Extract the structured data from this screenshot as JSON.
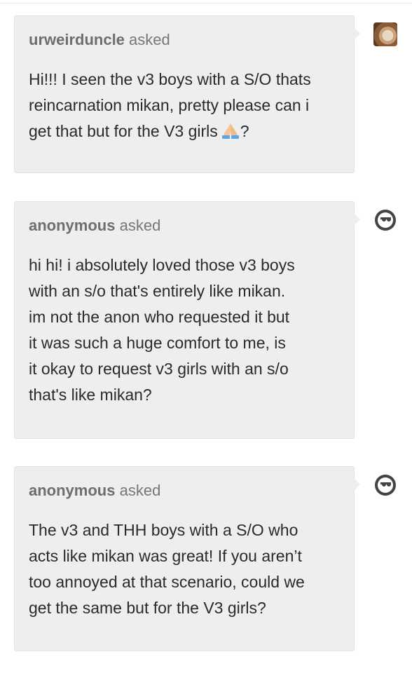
{
  "asks": [
    {
      "asker": "urweirduncle",
      "asked_label": "asked",
      "avatar": "user-photo",
      "question_text": "Hi!!! I seen the v3 boys with a S/O thats\nreincarnation mikan, pretty please can i\nget that but for the V3 girls",
      "question_emoji": "praying-hands-icon",
      "question_suffix": "?"
    },
    {
      "asker": "anonymous",
      "asked_label": "asked",
      "avatar": "anonymous-sunglasses-icon",
      "question_text": "hi hi! i absolutely loved those v3 boys\nwith an s/o that's entirely like mikan.\nim not the anon who requested it but\nit was such a huge comfort to me, is\nit okay to request v3 girls with an s/o\nthat's like mikan?"
    },
    {
      "asker": "anonymous",
      "asked_label": "asked",
      "avatar": "anonymous-sunglasses-icon",
      "question_text": "The v3 and THH boys with a S/O who\nacts like mikan was great! If you aren’t\ntoo annoyed at that scenario, could we\nget the same but for the V3 girls?"
    }
  ],
  "colors": {
    "card_background": "#eeeeee",
    "asker_name": "#6e6e6e",
    "question_text": "#2a2a2a"
  }
}
